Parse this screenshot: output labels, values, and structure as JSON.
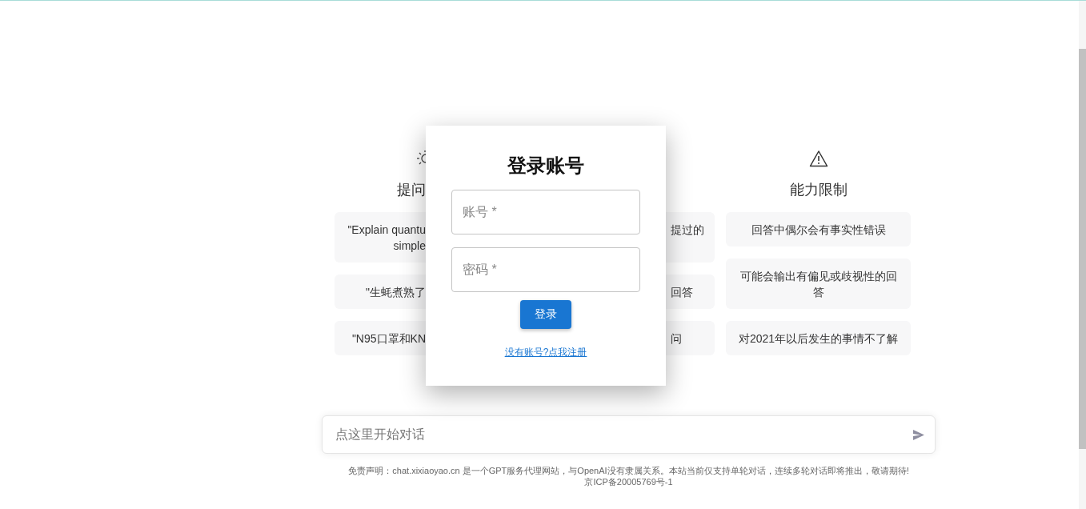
{
  "columns": [
    {
      "kind": "cut_right",
      "heading": "提问",
      "cards": [
        {
          "lines": [
            "\"Explain quantu",
            "simple"
          ]
        },
        {
          "lines": [
            "\"生蚝煮熟了"
          ]
        },
        {
          "lines": [
            "\"N95口罩和KN"
          ]
        }
      ]
    },
    {
      "kind": "cut_left",
      "cards": [
        {
          "lines": [
            "提过的"
          ]
        },
        {
          "lines": [
            "回答"
          ]
        },
        {
          "lines": [
            "问"
          ]
        }
      ]
    },
    {
      "kind": "full",
      "heading": "能力限制",
      "cards": [
        {
          "lines": [
            "回答中偶尔会有事实性错误"
          ]
        },
        {
          "lines": [
            "可能会输出有偏见或歧视性的回答"
          ]
        },
        {
          "lines": [
            "对2021年以后发生的事情不了解"
          ]
        }
      ]
    }
  ],
  "login": {
    "title": "登录账号",
    "fields": [
      {
        "placeholder": "账号 *"
      },
      {
        "placeholder": "密码 *"
      }
    ],
    "button": "登录",
    "register_link": "没有账号?点我注册"
  },
  "chat": {
    "placeholder": "点这里开始对话"
  },
  "footer": [
    "免责声明：chat.xixiaoyao.cn 是一个GPT服务代理网站，与OpenAI没有隶属关系。本站当前仅支持单轮对话，连续多轮对话即将推出，敬请期待!",
    "京ICP备20005769号-1"
  ]
}
